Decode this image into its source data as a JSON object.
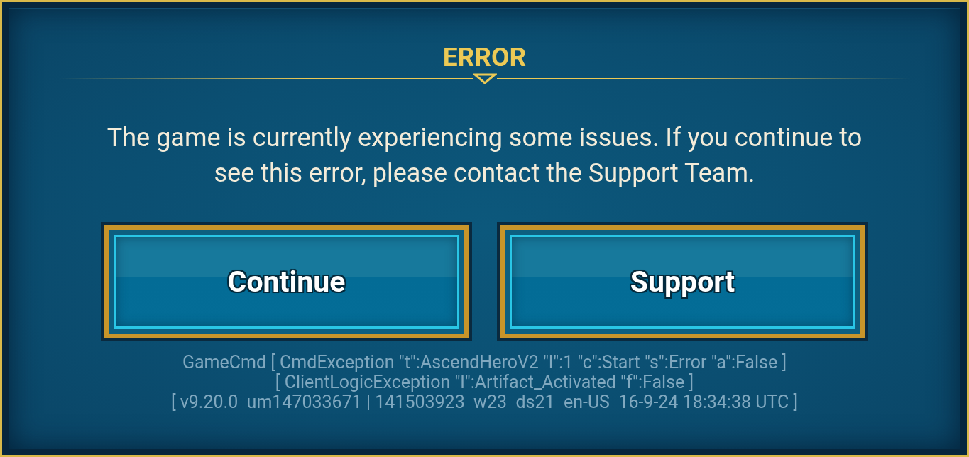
{
  "dialog": {
    "title": "ERROR",
    "message": "The game is currently experiencing some issues. If you continue to see this error, please contact the Support Team.",
    "buttons": [
      {
        "label": "Continue"
      },
      {
        "label": "Support"
      }
    ],
    "debug_lines": [
      "GameCmd [ CmdException \"t\":AscendHeroV2 \"l\":1 \"c\":Start \"s\":Error \"a\":False ]",
      "[ ClientLogicException \"l\":Artifact_Activated \"f\":False ]",
      "[ v9.20.0  um147033671 | 141503923  w23  ds21  en-US  16-9-24 18:34:38 UTC ]"
    ]
  }
}
